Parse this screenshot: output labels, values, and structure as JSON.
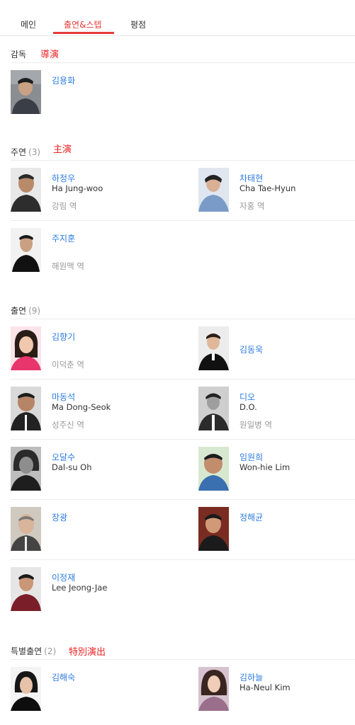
{
  "tabs": [
    {
      "label": "메인"
    },
    {
      "label": "출연&스텝"
    },
    {
      "label": "평점"
    }
  ],
  "annotations": {
    "director": "導演",
    "lead": "主演",
    "special": "特別演出"
  },
  "sections": {
    "director": {
      "title": "감독",
      "count": ""
    },
    "lead": {
      "title": "주연",
      "count": "(3)"
    },
    "cast": {
      "title": "출연",
      "count": "(9)"
    },
    "special": {
      "title": "특별출연",
      "count": "(2)"
    }
  },
  "people": {
    "director": [
      {
        "name": "김용화"
      }
    ],
    "lead": [
      {
        "name": "하정우",
        "name_en": "Ha Jung-woo",
        "role": "강림 역"
      },
      {
        "name": "차태현",
        "name_en": "Cha Tae-Hyun",
        "role": "자홍 역"
      },
      {
        "name": "주지훈",
        "name_en": "",
        "role": "해원맥 역"
      }
    ],
    "cast": [
      {
        "name": "김향기",
        "name_en": "",
        "role": "이덕춘 역"
      },
      {
        "name": "김동욱",
        "name_en": "",
        "role": ""
      },
      {
        "name": "마동석",
        "name_en": "Ma Dong-Seok",
        "role": "성주신 역"
      },
      {
        "name": "디오",
        "name_en": "D.O.",
        "role": "원일병 역"
      },
      {
        "name": "오달수",
        "name_en": "Dal-su Oh",
        "role": ""
      },
      {
        "name": "임원희",
        "name_en": "Won-hie Lim",
        "role": ""
      },
      {
        "name": "장광",
        "name_en": "",
        "role": ""
      },
      {
        "name": "정해균",
        "name_en": "",
        "role": ""
      },
      {
        "name": "이정재",
        "name_en": "Lee Jeong-Jae",
        "role": ""
      }
    ],
    "special": [
      {
        "name": "김해숙",
        "name_en": "",
        "role": ""
      },
      {
        "name": "김하늘",
        "name_en": "Ha-Neul Kim",
        "role": ""
      }
    ]
  }
}
